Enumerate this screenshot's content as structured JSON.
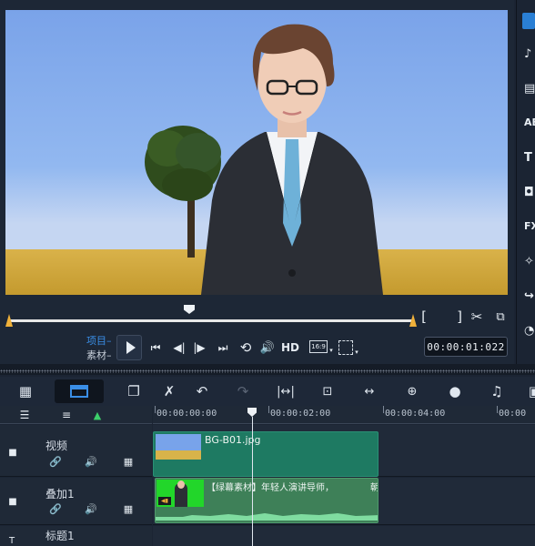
{
  "preview": {
    "mode_project": "项目",
    "mode_clip": "素材",
    "hd_label": "HD",
    "aspect_label": "16:9",
    "timecode": "00:00:01:022"
  },
  "timeline": {
    "ruler": [
      "00:00:00:00",
      "00:00:02:00",
      "00:00:04:00",
      "00:00"
    ],
    "tracks": [
      {
        "name": "视频"
      },
      {
        "name": "叠加1"
      },
      {
        "name": "标题1"
      }
    ],
    "clips": {
      "video": "BG-B01.jpg",
      "overlay": "【绿幕素材】年轻人演讲导师，",
      "overlay_tail": "朝"
    }
  },
  "colors": {
    "accent": "#3a8ee6",
    "clip_green": "#1e7a62",
    "overlay_green": "#3e8058",
    "mark_orange": "#f0b13a"
  }
}
